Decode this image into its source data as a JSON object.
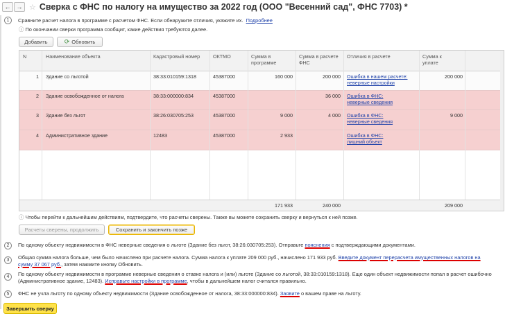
{
  "window": {
    "title": "Сверка с ФНС по налогу на имущество за 2022 год (ООО \"Весенний сад\", ФНС 7703) *"
  },
  "step1": {
    "num": "1",
    "text": "Сравните расчет налога в программе с расчетом ФНС. Если обнаружите отличия, укажите их.",
    "link": "Подробнее",
    "info": "По окончании сверки программа сообщит, какие действия требуются далее.",
    "add_button": "Добавить",
    "refresh_button": "Обновить"
  },
  "table": {
    "columns": [
      "N",
      "Наименование объекта",
      "Кадастровый номер",
      "ОКТМО",
      "Сумма в программе",
      "Сумма в расчете ФНС",
      "Отличия в расчете",
      "Сумма к уплате"
    ],
    "rows": [
      {
        "n": "1",
        "name": "Здание со льготой",
        "cad": "38:33:010159:1318",
        "oktmo": "45387000",
        "prog": "160 000",
        "fns": "200 000",
        "diff1": "Ошибка в нашем расчете:",
        "diff2": "неверные настройки",
        "pay": "200 000"
      },
      {
        "n": "2",
        "name": "Здание освобожденное от налога",
        "cad": "38:33:000000:834",
        "oktmo": "45387000",
        "prog": "",
        "fns": "36 000",
        "diff1": "Ошибка в ФНС:",
        "diff2": "неверные сведения",
        "pay": ""
      },
      {
        "n": "3",
        "name": "Здание без льгот",
        "cad": "38:26:030705:253",
        "oktmo": "45387000",
        "prog": "9 000",
        "fns": "4 000",
        "diff1": "Ошибка в ФНС:",
        "diff2": "неверные сведения",
        "pay": "9 000"
      },
      {
        "n": "4",
        "name": "Административное здание",
        "cad": "12483",
        "oktmo": "45387000",
        "prog": "2 933",
        "fns": "",
        "diff1": "Ошибка в ФНС:",
        "diff2": "лишний объект",
        "pay": ""
      }
    ],
    "totals": {
      "prog": "171 933",
      "fns": "240 000",
      "pay": "209 000"
    }
  },
  "confirm": {
    "info": "Чтобы перейти к дальнейшим действиям, подтвердите, что расчеты сверены. Также вы можете сохранить сверку и вернуться к ней позже.",
    "done_button": "Расчеты сверены, продолжить",
    "save_button": "Сохранить и закончить позже"
  },
  "step2": {
    "num": "2",
    "text_a": "По одному объекту недвижимости в ФНС неверные сведения о льготе (Здание без льгот, 38:26:030705:253). Отправьте",
    "link": "пояснения",
    "text_b": "с подтверждающими документами."
  },
  "step3": {
    "num": "3",
    "line1": "Общая сумма налога больше, чем было начислено при расчете налога.  Сумма налога к уплате 209 000 руб., начислено 171 933 руб.",
    "link1": "Введите документ перерасчета имущественных налогов на",
    "link2": "сумму 37 067 руб.",
    "line2": ", затем нажмите кнопку Обновить."
  },
  "step4": {
    "num": "4",
    "line1": "По одному объекту недвижимости в программе неверные сведения о ставке налога и (или) льготе (Здание со льготой, 38:33:010159:1318). Еще один объект недвижимости попал в расчет ошибочно",
    "line2a": "(Административное здание, 12483).",
    "link": "Исправьте настройки в программе",
    "line2b": ", чтобы в дальнейшем налог считался правильно."
  },
  "step5": {
    "num": "5",
    "text_a": "ФНС не учла льготу по одному объекту недвижимости (Здание освобожденное от налога, 38:33:000000:834).",
    "link": "Заявите",
    "text_b": "о вашем праве на льготу."
  },
  "finish_button": "Завершить сверку"
}
